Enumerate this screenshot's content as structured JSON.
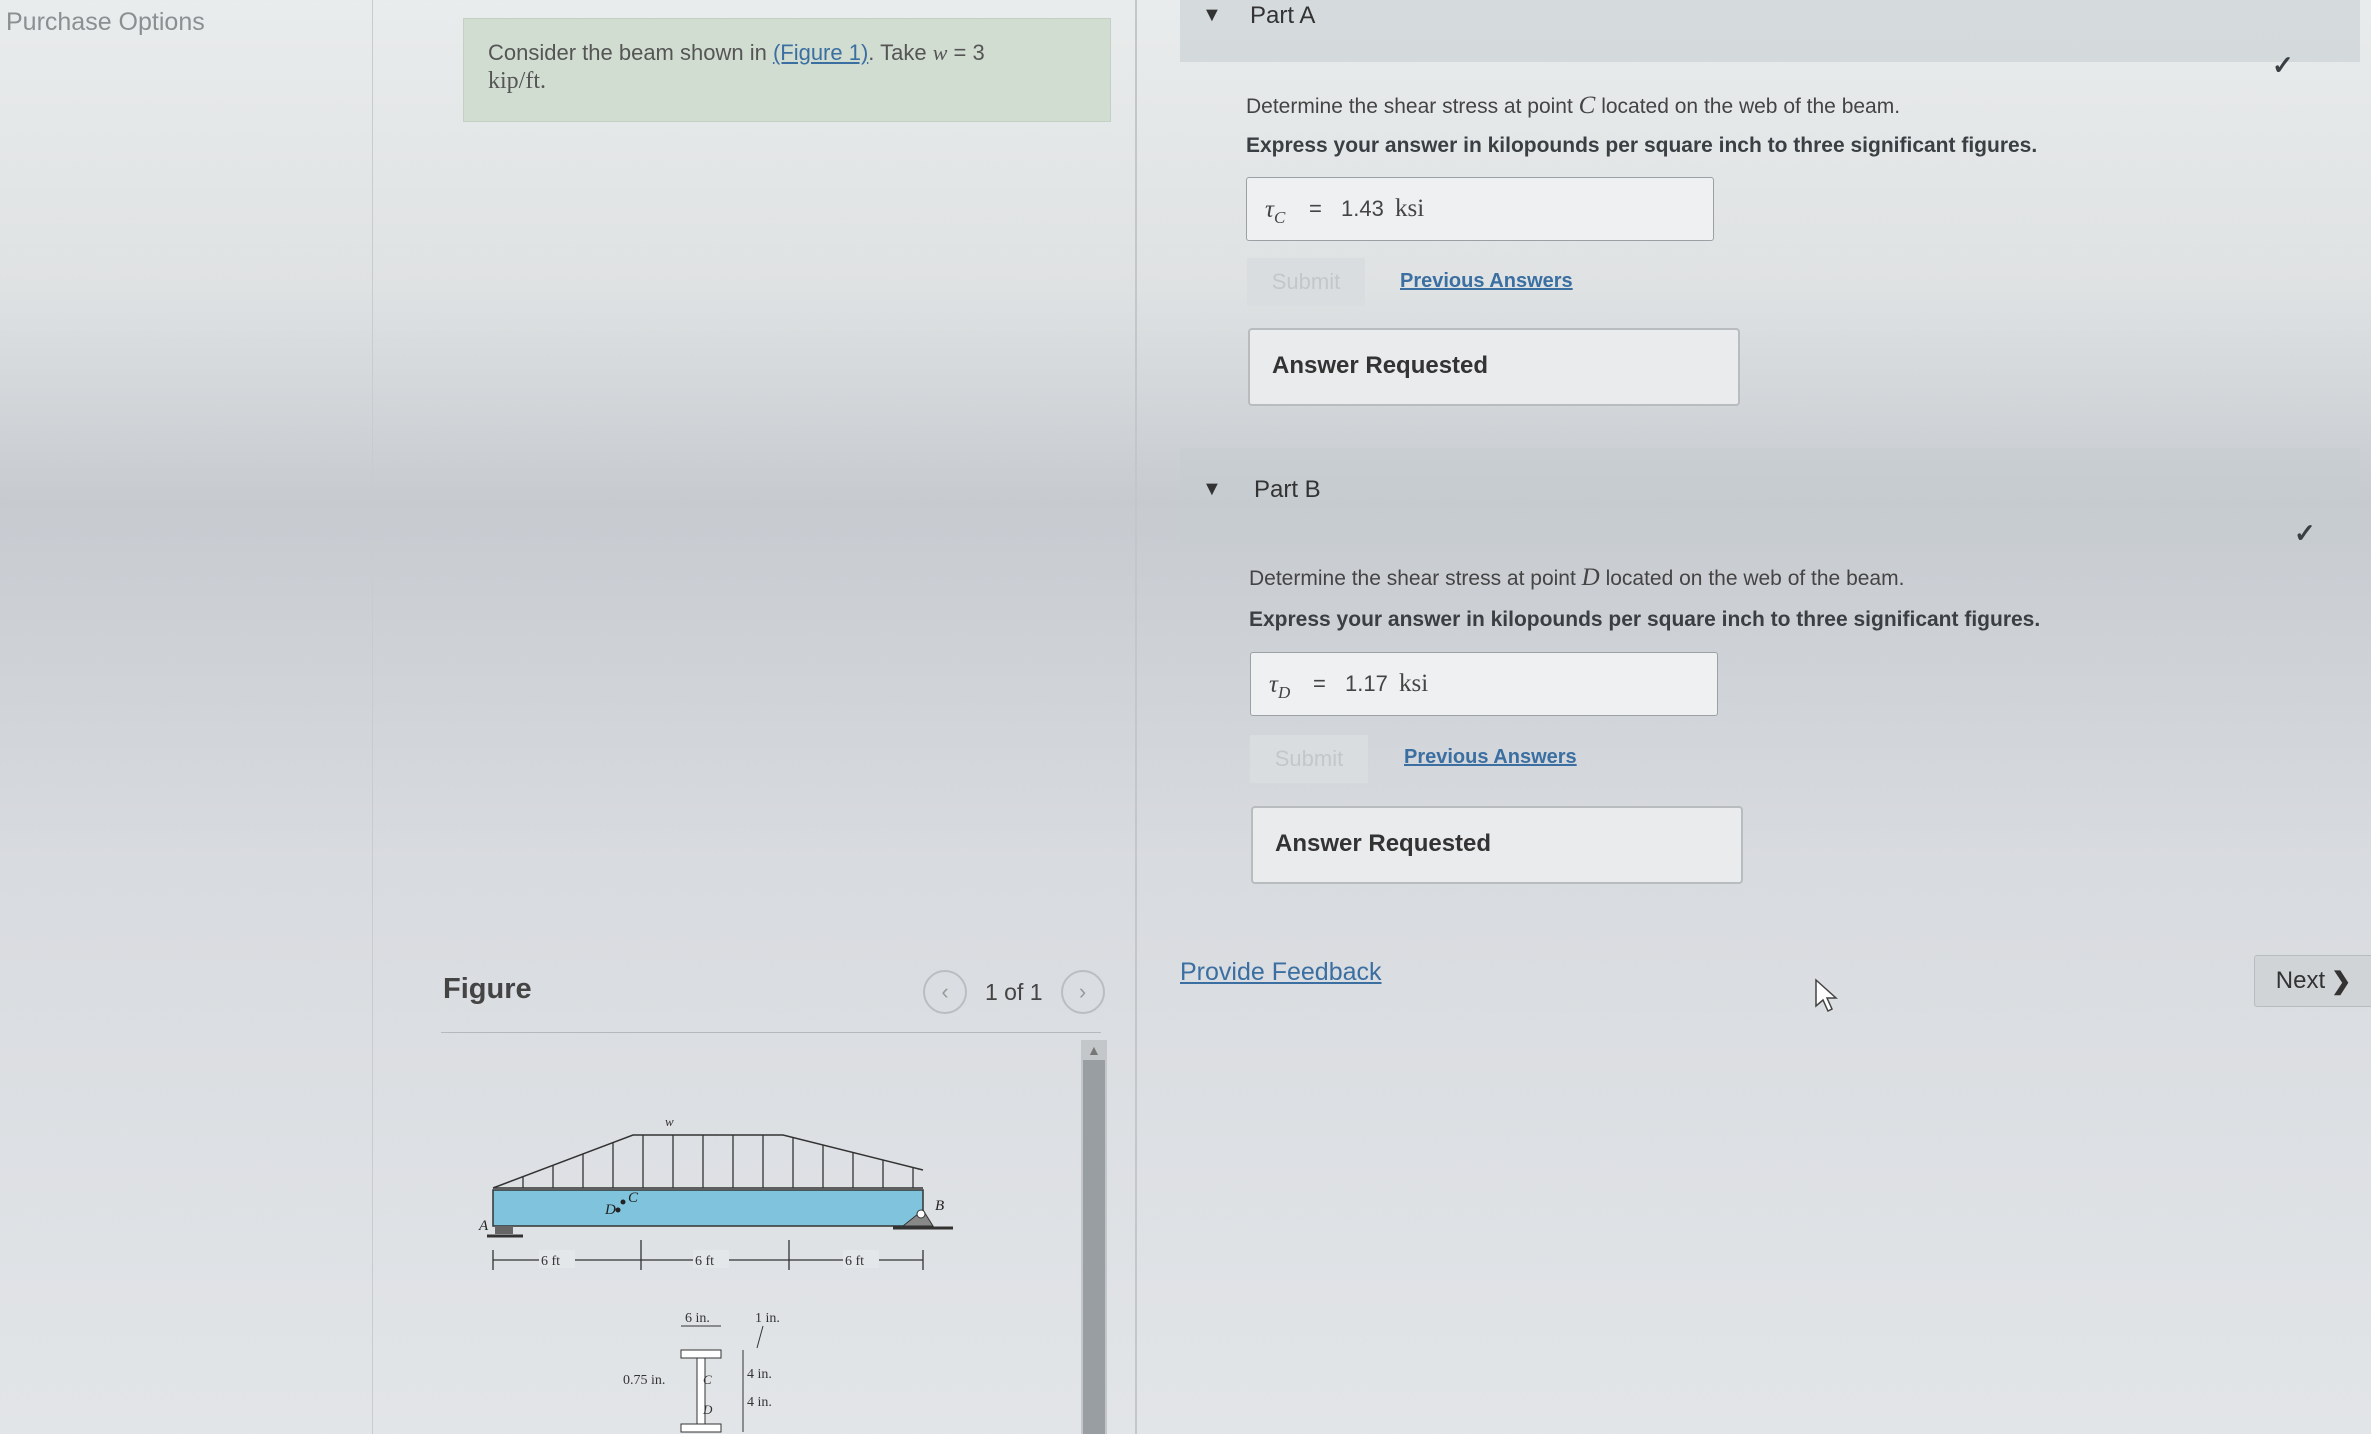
{
  "left": {
    "purchase_options": "Purchase Options"
  },
  "problem": {
    "text_before": "Consider the beam shown in ",
    "figure_link": "(Figure 1)",
    "text_mid": ". Take ",
    "w_var": "w",
    "w_value": " = 3",
    "unit": "kip/ft",
    "text_end": "."
  },
  "figure": {
    "label": "Figure",
    "pager_text": "1 of 1",
    "prev_icon": "chevron-left-icon",
    "next_icon": "chevron-right-icon",
    "diagram": {
      "load_label": "w",
      "point_a": "A",
      "point_b": "B",
      "point_c": "C",
      "point_d": "D",
      "span1": "6 ft",
      "span2": "6 ft",
      "span3": "6 ft",
      "flange_width": "6 in.",
      "flange_thickness": "1 in.",
      "web_thickness": "0.75 in.",
      "dim1": "4 in.",
      "dim2": "4 in."
    }
  },
  "partA": {
    "title": "Part A",
    "question_before": "Determine the shear stress at point ",
    "question_var": "C",
    "question_after": " located on the web of the beam.",
    "instruction": "Express your answer in kilopounds per square inch to three significant figures.",
    "answer_symbol": "τ",
    "answer_sub": "C",
    "answer_eq": "=",
    "answer_value": "1.43",
    "answer_unit": "ksi",
    "submit_label": "Submit",
    "previous_answers": "Previous Answers",
    "answer_requested": "Answer Requested",
    "status_icon": "checkmark-icon"
  },
  "partB": {
    "title": "Part B",
    "question_before": "Determine the shear stress at point ",
    "question_var": "D",
    "question_after": " located on the web of the beam.",
    "instruction": "Express your answer in kilopounds per square inch to three significant figures.",
    "answer_symbol": "τ",
    "answer_sub": "D",
    "answer_eq": "=",
    "answer_value": "1.17",
    "answer_unit": "ksi",
    "submit_label": "Submit",
    "previous_answers": "Previous Answers",
    "answer_requested": "Answer Requested",
    "status_icon": "checkmark-icon"
  },
  "footer": {
    "provide_feedback": "Provide Feedback",
    "next_label": "Next",
    "next_icon": "chevron-right-icon"
  }
}
